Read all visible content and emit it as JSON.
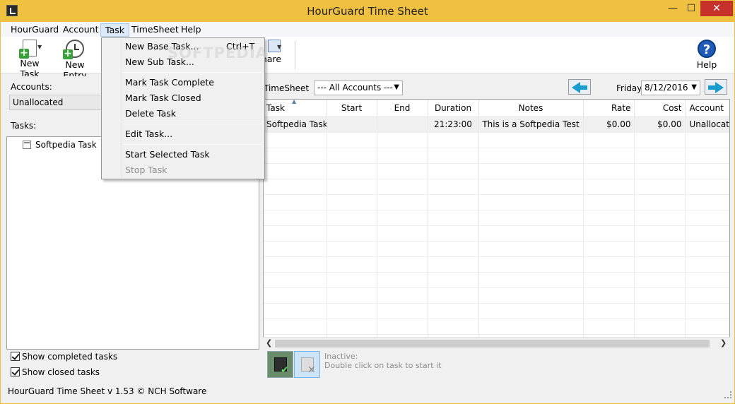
{
  "window": {
    "title": "HourGuard Time Sheet",
    "min_glyph": "—",
    "max_glyph": "☐",
    "close_glyph": "✕"
  },
  "menubar": {
    "items": [
      "HourGuard",
      "Account",
      "Task",
      "TimeSheet",
      "Help"
    ]
  },
  "toolbar": {
    "new_task": "New Task",
    "new_entry": "New Entry",
    "share": "hare",
    "help": "Help",
    "help_glyph": "?"
  },
  "task_menu": {
    "items": [
      {
        "label": "New Base Task...",
        "shortcut": "Ctrl+T"
      },
      {
        "label": "New Sub Task..."
      },
      {
        "label": "Mark Task Complete"
      },
      {
        "label": "Mark Task Closed"
      },
      {
        "label": "Delete Task"
      },
      {
        "label": "Edit Task..."
      },
      {
        "label": "Start Selected Task"
      },
      {
        "label": "Stop Task",
        "disabled": true
      }
    ]
  },
  "left_panel": {
    "accounts_label": "Accounts:",
    "accounts_value": "Unallocated",
    "tasks_label": "Tasks:",
    "tasks": [
      "Softpedia Task"
    ],
    "show_completed": "Show completed tasks",
    "show_closed": "Show closed tasks"
  },
  "timesheet": {
    "label": "TimeSheet",
    "accounts_filter": "--- All Accounts ---",
    "day": "Friday",
    "date": "8/12/2016",
    "columns": [
      "Task",
      "Start",
      "End",
      "Duration",
      "Notes",
      "Rate",
      "Cost",
      "Account"
    ],
    "rows": [
      [
        "Softpedia Task",
        "",
        "",
        "21:23:00",
        "This is a Softpedia Test",
        "$0.00",
        "$0.00",
        "Unallocated"
      ]
    ]
  },
  "inactive": {
    "line1": "Inactive:",
    "line2": "Double click on task to start it"
  },
  "status": {
    "text": "HourGuard Time Sheet v 1.53 © NCH Software"
  },
  "watermark": "SOFTPEDIA",
  "colors": {
    "titlebar": "#f0c040",
    "close": "#c7312b",
    "accent_arrow": "#1a9bcd"
  },
  "icons": [
    "app-icon",
    "new-task-icon",
    "new-entry-icon",
    "share-icon",
    "help-icon",
    "prev-day-arrow-icon",
    "next-day-arrow-icon",
    "task-icon",
    "start-timer-icon",
    "stop-timer-icon"
  ]
}
